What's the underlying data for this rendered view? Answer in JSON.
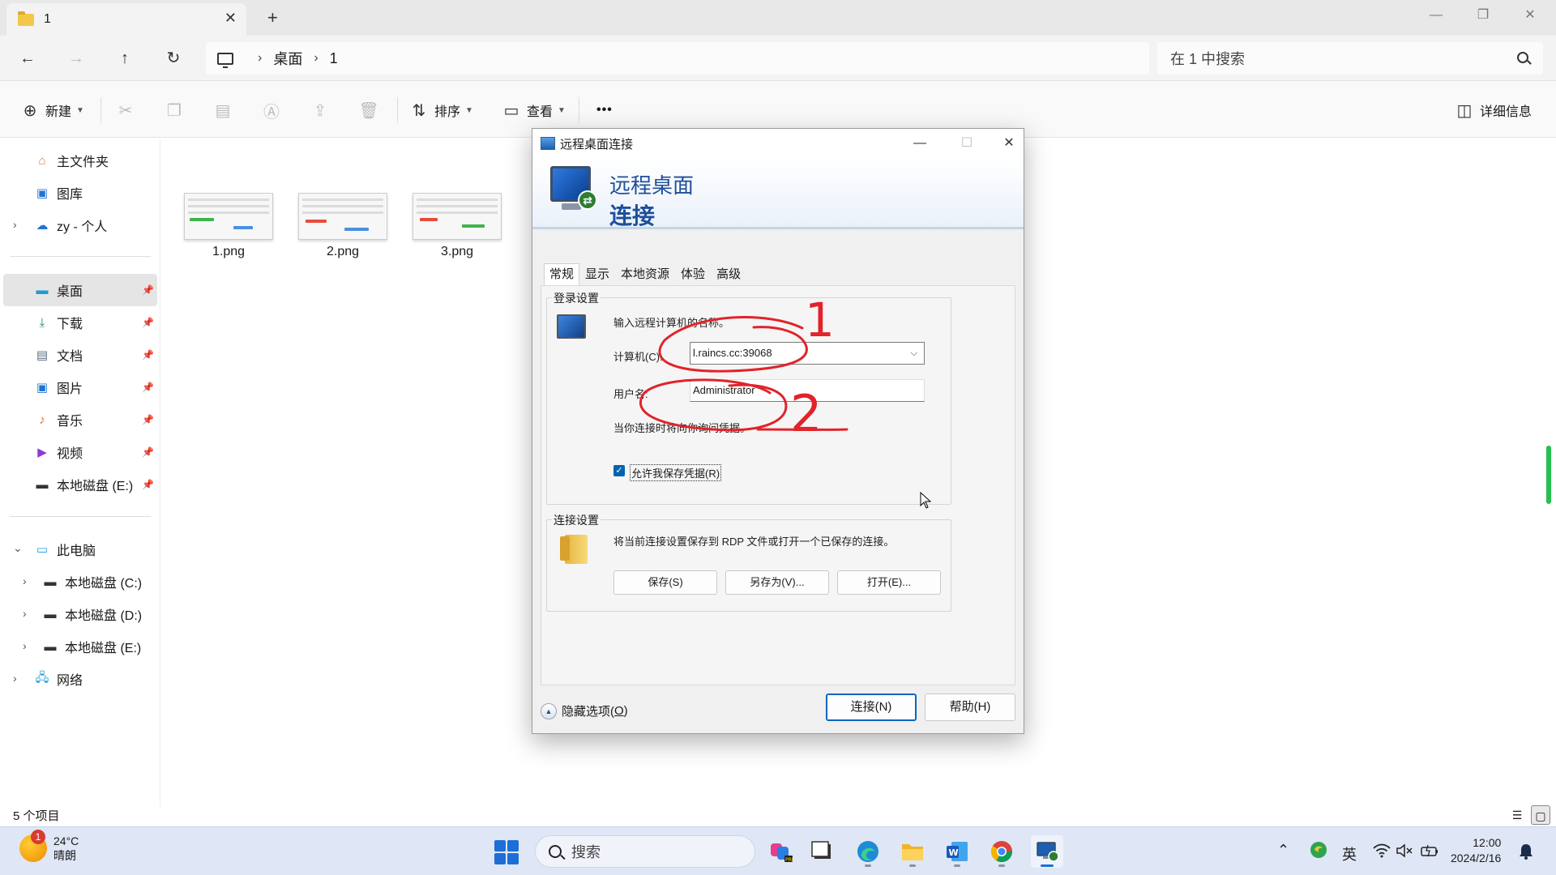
{
  "window": {
    "tab_title": "1",
    "tab_close": "✕",
    "tab_add": "+",
    "controls": {
      "minimize": "—",
      "restore": "❐",
      "close": "✕"
    }
  },
  "address": {
    "back": "←",
    "forward": "→",
    "up": "↑",
    "refresh": "↻",
    "separator": "›",
    "path": [
      "桌面",
      "1"
    ],
    "search_placeholder": "在 1 中搜索"
  },
  "toolbar": {
    "new_label": "新建",
    "sort_label": "排序",
    "view_label": "查看",
    "more": "•••",
    "details_label": "详细信息",
    "icons": [
      "cut-icon",
      "copy-icon",
      "paste-icon",
      "rename-icon",
      "share-icon",
      "delete-icon"
    ]
  },
  "sidebar": {
    "top": [
      {
        "label": "主文件夹",
        "icon": "home-icon"
      },
      {
        "label": "图库",
        "icon": "gallery-icon"
      },
      {
        "label": "zy - 个人",
        "icon": "onedrive-icon"
      }
    ],
    "pinned": [
      {
        "label": "桌面",
        "icon": "desktop-icon"
      },
      {
        "label": "下载",
        "icon": "download-icon"
      },
      {
        "label": "文档",
        "icon": "documents-icon"
      },
      {
        "label": "图片",
        "icon": "pictures-icon"
      },
      {
        "label": "音乐",
        "icon": "music-icon"
      },
      {
        "label": "视频",
        "icon": "videos-icon"
      },
      {
        "label": "本地磁盘 (E:)",
        "icon": "drive-icon"
      }
    ],
    "this_pc": "此电脑",
    "drives": [
      "本地磁盘 (C:)",
      "本地磁盘 (D:)",
      "本地磁盘 (E:)"
    ],
    "network": "网络"
  },
  "files": [
    {
      "name": "1.png"
    },
    {
      "name": "2.png"
    },
    {
      "name": "3.png"
    }
  ],
  "status": {
    "item_count": "5 个项目"
  },
  "dialog": {
    "title": "远程桌面连接",
    "header_line1": "远程桌面",
    "header_line2": "连接",
    "tabs": [
      "常规",
      "显示",
      "本地资源",
      "体验",
      "高级"
    ],
    "logon_group": "登录设置",
    "logon_prompt": "输入远程计算机的名称。",
    "computer_label": "计算机(C):",
    "computer_value": "l.raincs.cc:39068",
    "username_label": "用户名:",
    "username_value": "Administrator",
    "credential_note": "当你连接时将向你询问凭据。",
    "allow_save_label": "允许我保存凭据(R)",
    "allow_save_checked": true,
    "conn_group": "连接设置",
    "conn_desc": "将当前连接设置保存到 RDP 文件或打开一个已保存的连接。",
    "save_btn": "保存(S)",
    "save_as_btn": "另存为(V)...",
    "open_btn": "打开(E)...",
    "hide_options_prefix": "隐藏选项(",
    "hide_options_key": "O",
    "hide_options_suffix": ")",
    "connect_btn": "连接(N)",
    "help_btn": "帮助(H)"
  },
  "annotations": {
    "mark1": "1",
    "mark2": "2",
    "color": "#e0242b"
  },
  "taskbar": {
    "weather_badge": "1",
    "temperature": "24°C",
    "condition": "晴朗",
    "search_placeholder": "搜索",
    "ime": "英",
    "time": "12:00",
    "date": "2024/2/16",
    "apps": [
      "copilot-icon",
      "terminal-icon",
      "edge-icon",
      "file-explorer-icon",
      "word-icon",
      "chrome-icon",
      "remote-desktop-icon"
    ]
  }
}
